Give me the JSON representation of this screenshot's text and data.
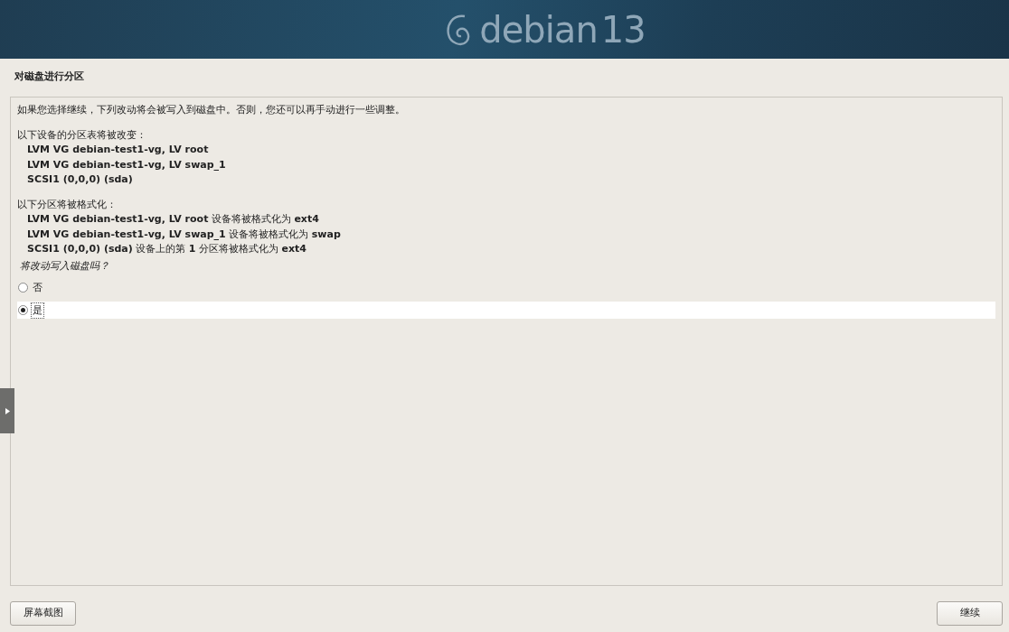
{
  "banner": {
    "logo_text": "debian",
    "version": "13"
  },
  "page_title": "对磁盘进行分区",
  "intro": "如果您选择继续，下列改动将会被写入到磁盘中。否则，您还可以再手动进行一些调整。",
  "partition_tables": {
    "heading": "以下设备的分区表将被改变：",
    "items": [
      "LVM VG debian-test1-vg, LV root",
      "LVM VG debian-test1-vg, LV swap_1",
      "SCSI1 (0,0,0) (sda)"
    ]
  },
  "formats": {
    "heading": "以下分区将被格式化：",
    "items": [
      "**LVM VG debian-test1-vg, LV root** 设备将被格式化为 **ext4**",
      "**LVM VG debian-test1-vg, LV swap_1** 设备将被格式化为 **swap**",
      "**SCSI1 (0,0,0) (sda)** 设备上的第 **1** 分区将被格式化为 **ext4**"
    ]
  },
  "question": "将改动写入磁盘吗？",
  "options": [
    {
      "label": "否",
      "selected": false
    },
    {
      "label": "是",
      "selected": true
    }
  ],
  "buttons": {
    "left": "屏幕截图",
    "right": "继续"
  }
}
